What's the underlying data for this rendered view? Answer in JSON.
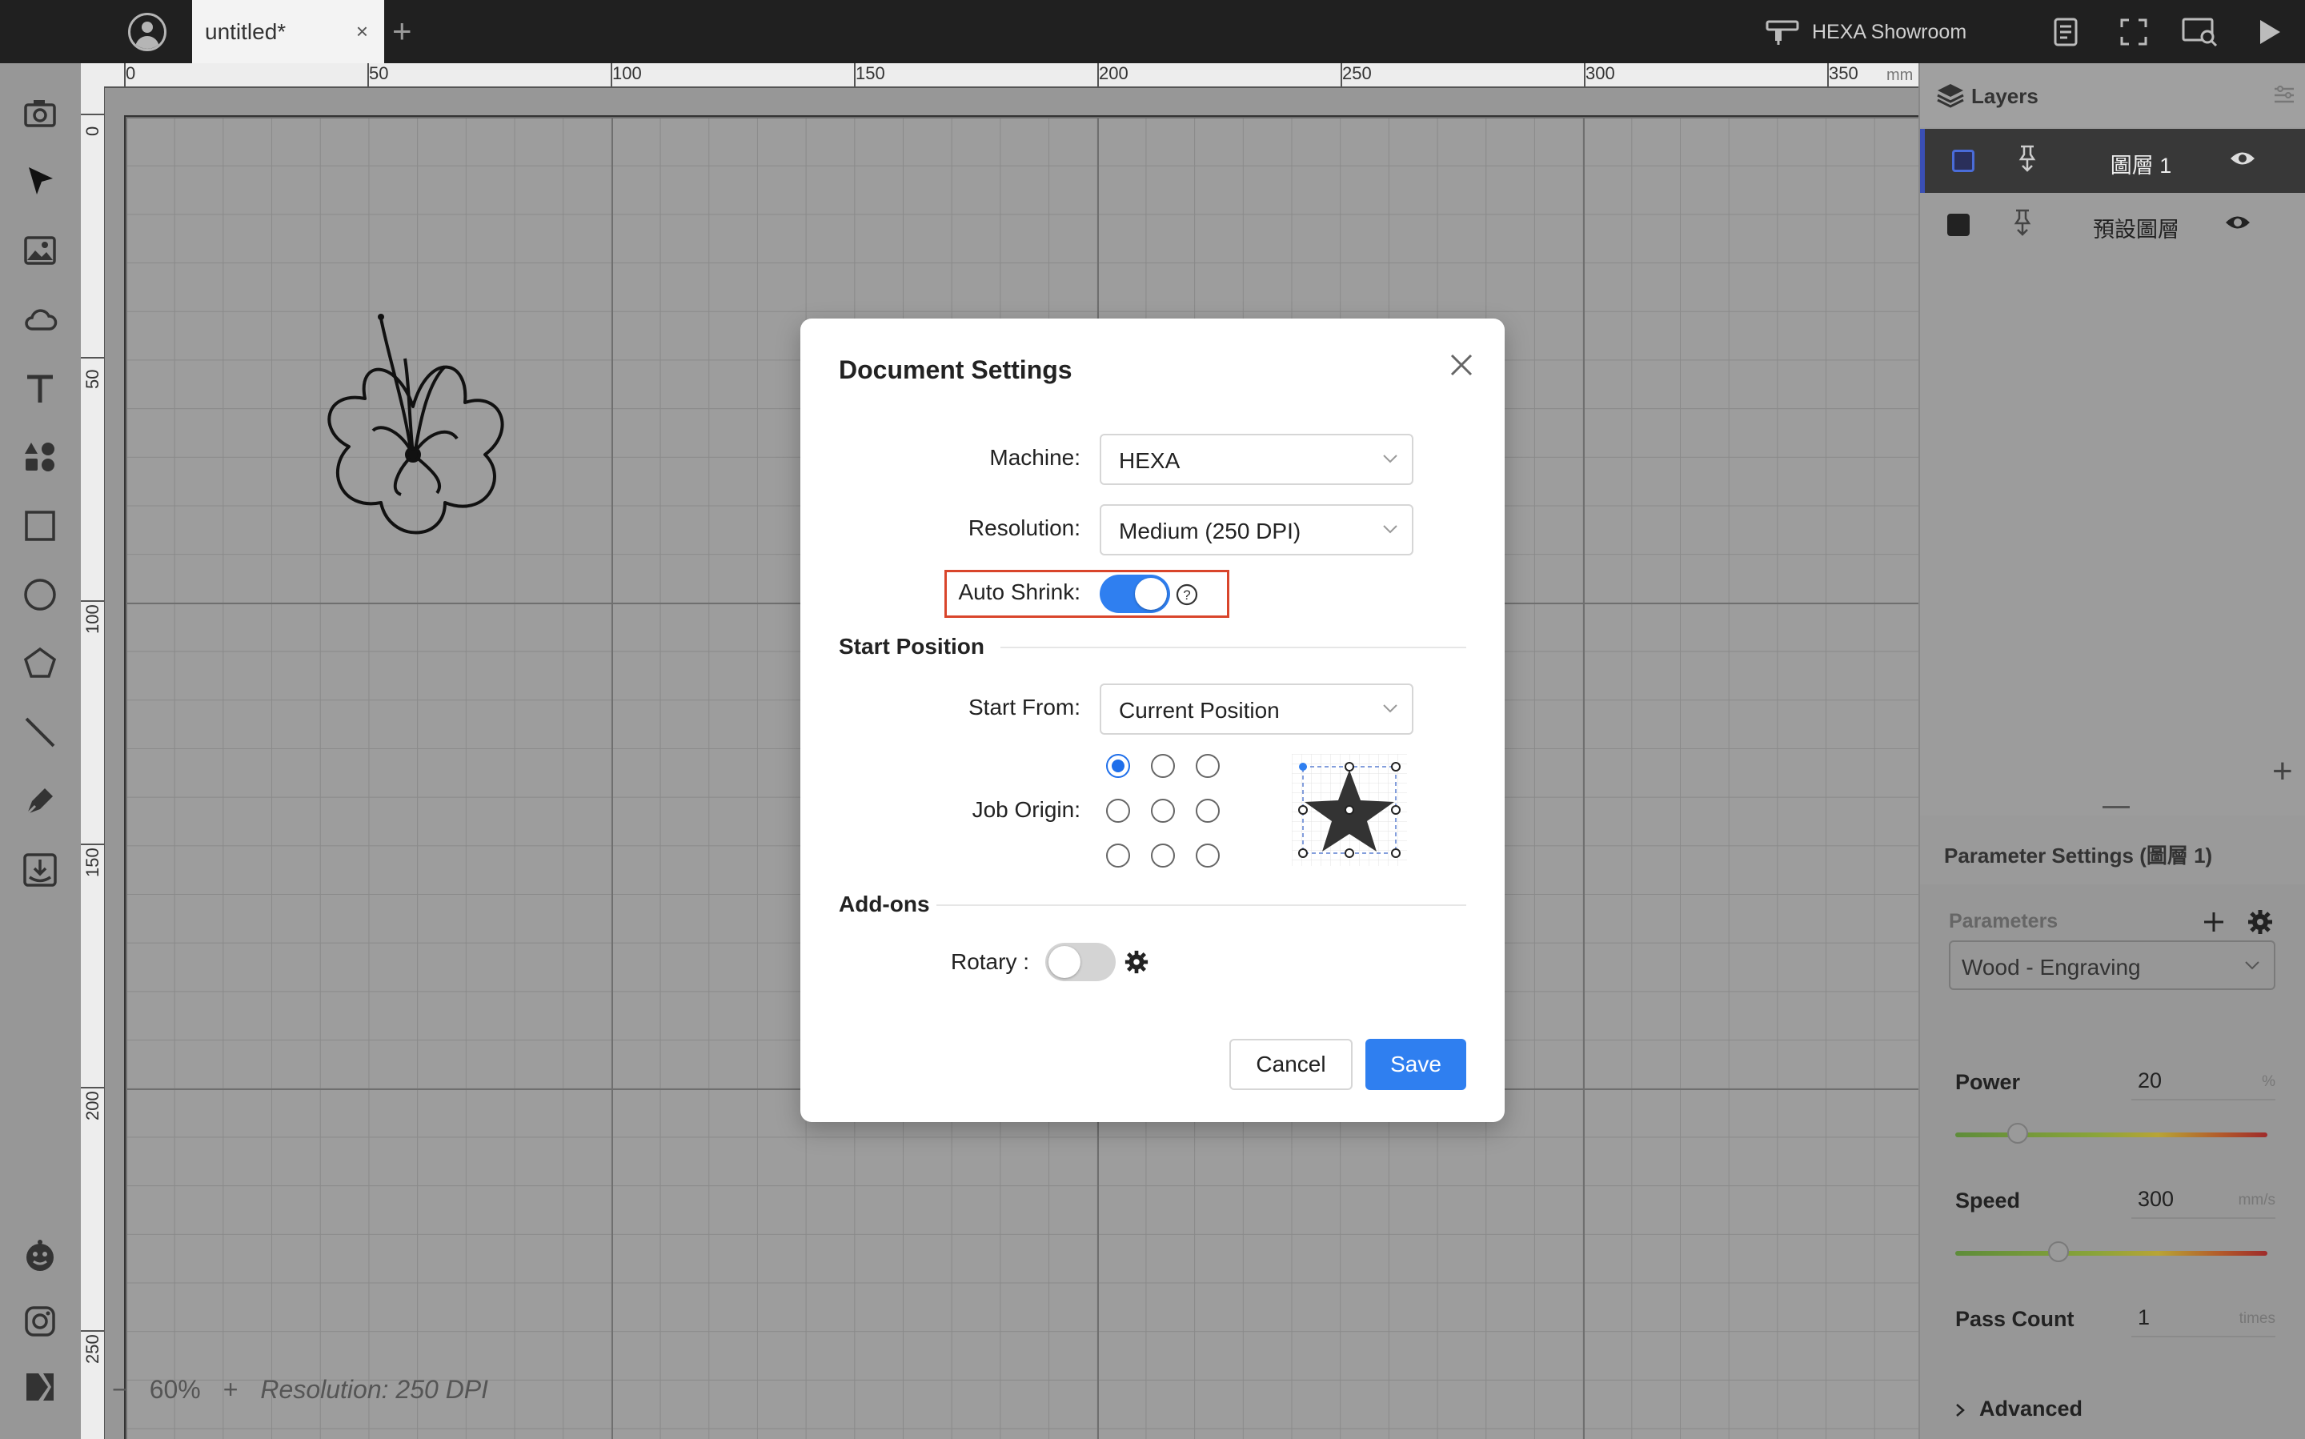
{
  "topbar": {
    "tab_title": "untitled*",
    "tab_close": "×",
    "new_tab": "+",
    "device_label": "HEXA Showroom"
  },
  "ruler": {
    "top_ticks": [
      "0",
      "50",
      "100",
      "150",
      "200",
      "250",
      "300",
      "350",
      "mm"
    ],
    "left_ticks": [
      "0",
      "50",
      "100",
      "150",
      "200",
      "250"
    ]
  },
  "canvas": {
    "zoom_minus": "−",
    "zoom_value": "60%",
    "zoom_plus": "+",
    "resolution_info": "Resolution: 250 DPI"
  },
  "layers": {
    "title": "Layers",
    "items": [
      {
        "name": "圖層 1",
        "color": "#3a4fb5",
        "active": true
      },
      {
        "name": "預設圖層",
        "color": "#222222",
        "active": false
      }
    ],
    "add_label": "+"
  },
  "parameter_settings": {
    "title": "Parameter Settings (圖層 1)",
    "parameters_label": "Parameters",
    "preset": "Wood - Engraving",
    "power": {
      "label": "Power",
      "value": "20",
      "unit": "%",
      "fraction": 0.2
    },
    "speed": {
      "label": "Speed",
      "value": "300",
      "unit": "mm/s",
      "fraction": 0.33
    },
    "pass_count": {
      "label": "Pass Count",
      "value": "1",
      "unit": "times"
    },
    "advanced_label": "Advanced"
  },
  "modal": {
    "title": "Document Settings",
    "machine_label": "Machine:",
    "machine_value": "HEXA",
    "resolution_label": "Resolution:",
    "resolution_value": "Medium (250 DPI)",
    "auto_shrink_label": "Auto Shrink:",
    "auto_shrink_on": true,
    "help_icon": "?",
    "start_position_title": "Start Position",
    "start_from_label": "Start From:",
    "start_from_value": "Current Position",
    "job_origin_label": "Job Origin:",
    "addons_title": "Add-ons",
    "rotary_label": "Rotary :",
    "rotary_on": false,
    "cancel_label": "Cancel",
    "save_label": "Save"
  },
  "colors": {
    "accent": "#2f7ff0",
    "highlight_border": "#d9452b",
    "topbar": "#202020"
  }
}
